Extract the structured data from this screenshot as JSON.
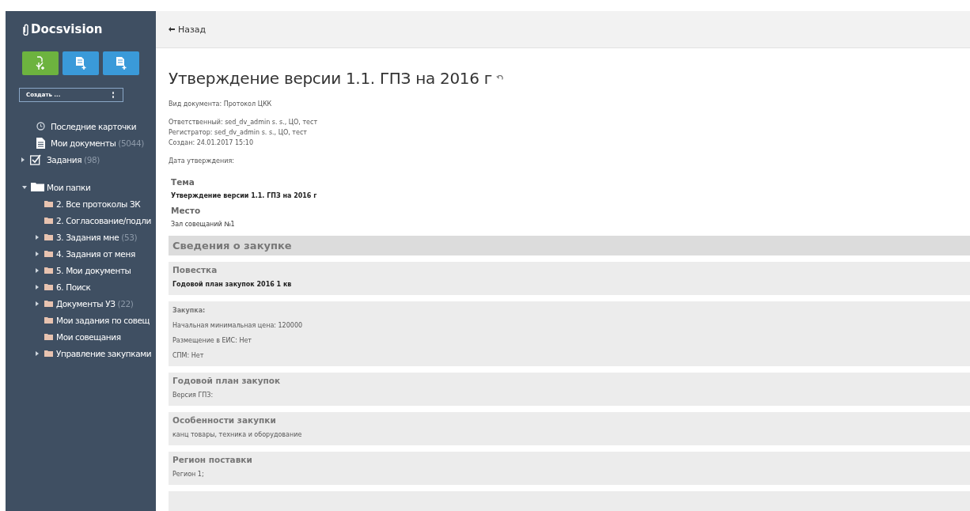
{
  "logo": "Docsvision",
  "create_buttons": [
    {
      "kind": "task",
      "color": "#6db33f"
    },
    {
      "kind": "doc",
      "color": "#3a9ad9"
    },
    {
      "kind": "doc",
      "color": "#3a9ad9"
    }
  ],
  "create_select": {
    "value": "Создать ..."
  },
  "nav": [
    {
      "kind": "clock",
      "label": "Последние карточки",
      "expandable": false
    },
    {
      "kind": "doc",
      "label": "Мои документы",
      "count": "(5044)",
      "expandable": false
    },
    {
      "kind": "check",
      "label": "Задания",
      "count": "(98)",
      "expandable": true
    }
  ],
  "folders": {
    "label": "Мои папки",
    "expanded": true,
    "children": [
      {
        "label": "2. Все протоколы ЗК",
        "expandable": false
      },
      {
        "label": "2. Согласование/подли",
        "expandable": false
      },
      {
        "label": "3. Задания мне",
        "count": "(53)",
        "expandable": true
      },
      {
        "label": "4. Задания от меня",
        "expandable": true
      },
      {
        "label": "5. Мои документы",
        "expandable": true
      },
      {
        "label": "6. Поиск",
        "expandable": true
      },
      {
        "label": "Документы УЗ",
        "count": "(22)",
        "expandable": true
      },
      {
        "label": "Мои задания по совещ",
        "expandable": false
      },
      {
        "label": "Мои совещания",
        "expandable": false
      },
      {
        "label": "Управление закупками",
        "expandable": true
      }
    ]
  },
  "back": "Назад",
  "title": "Утверждение версии 1.1. ГПЗ на 2016 г",
  "meta": [
    [
      "Вид документа: Протокол ЦКК"
    ],
    [
      "Ответственный: sed_dv_admin s. s., ЦО, тест",
      "Регистратор: sed_dv_admin s. s., ЦО, тест",
      "Создан: 24.01.2017 15:10"
    ],
    [
      "Дата утверждения:"
    ]
  ],
  "fields": [
    {
      "label": "Тема",
      "value": "Утверждение версии 1.1. ГПЗ на 2016 г"
    },
    {
      "label": "Место",
      "value": "Зал совещаний №1"
    }
  ],
  "section": {
    "title": "Сведения о закупке",
    "blocks": [
      {
        "kind": "heading",
        "title": "Повестка",
        "lines": [
          {
            "text": "Годовой план закупок 2016 1 кв",
            "bold": true
          }
        ]
      },
      {
        "kind": "label",
        "title": "Закупка:",
        "lines": [
          {
            "text": "Начальная минимальная цена: 120000",
            "bold": false
          },
          {
            "text": "Размещение в ЕИС: Нет",
            "bold": false
          },
          {
            "text": "СПМ: Нет",
            "bold": false
          }
        ]
      },
      {
        "kind": "heading",
        "title": "Годовой план закупок",
        "lines": [
          {
            "text": "Версия ГПЗ:",
            "bold": false
          }
        ]
      },
      {
        "kind": "heading",
        "title": "Особенности закупки",
        "lines": [
          {
            "text": "канц товары, техника и оборудование",
            "bold": false
          }
        ]
      },
      {
        "kind": "heading",
        "title": "Регион поставки",
        "lines": [
          {
            "text": "Регион 1;",
            "bold": false
          }
        ]
      }
    ]
  }
}
